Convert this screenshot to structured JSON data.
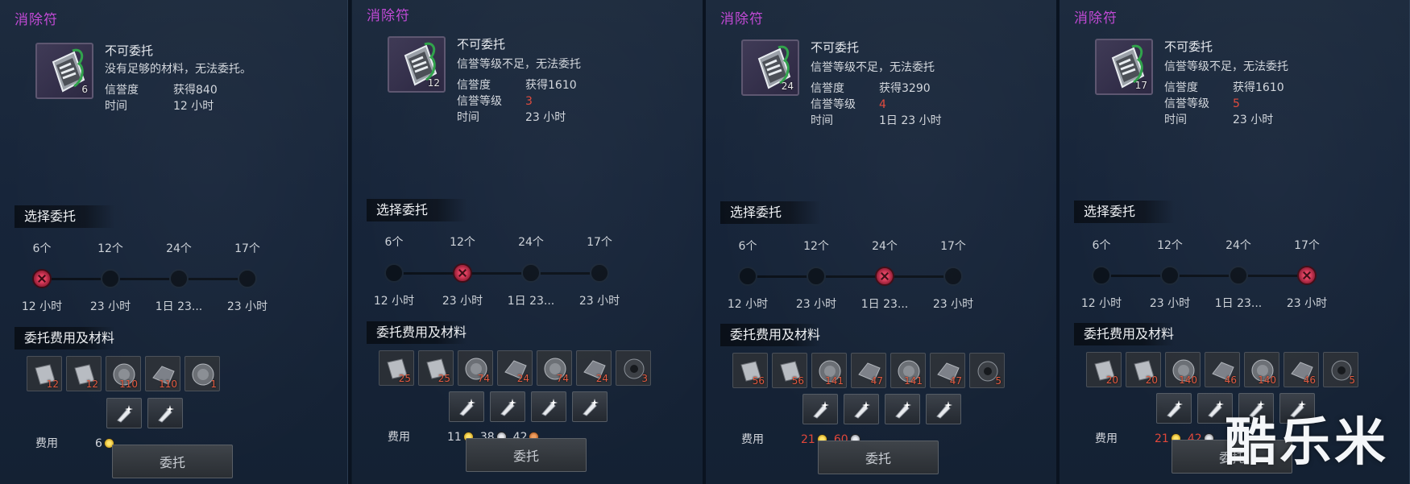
{
  "panels": [
    {
      "title": "消除符",
      "item_name": "不可委托",
      "reason": "没有足够的材料，无法委托。",
      "thumb_count": "6",
      "info": [
        {
          "key": "信誉度",
          "value": "获得840",
          "red": false
        },
        {
          "key": "时间",
          "value": "12 小时",
          "red": false
        }
      ],
      "section_select": "选择委托",
      "options": [
        {
          "count": "6个",
          "time": "12 小时"
        },
        {
          "count": "12个",
          "time": "23 小时"
        },
        {
          "count": "24个",
          "time": "1日 23..."
        },
        {
          "count": "17个",
          "time": "23 小时"
        }
      ],
      "selected_index": 0,
      "section_materials": "委托费用及材料",
      "materials": [
        "12",
        "12",
        "110",
        "110",
        "1"
      ],
      "sub_materials": 2,
      "fee_label": "费用",
      "fees": [
        {
          "amount": "6",
          "coin": "gold",
          "red": false
        }
      ],
      "button": "委托"
    },
    {
      "title": "消除符",
      "item_name": "不可委托",
      "reason": "信誉等级不足，无法委托",
      "thumb_count": "12",
      "info": [
        {
          "key": "信誉度",
          "value": "获得1610",
          "red": false
        },
        {
          "key": "信誉等级",
          "value": "3",
          "red": true
        },
        {
          "key": "时间",
          "value": "23 小时",
          "red": false
        }
      ],
      "section_select": "选择委托",
      "options": [
        {
          "count": "6个",
          "time": "12 小时"
        },
        {
          "count": "12个",
          "time": "23 小时"
        },
        {
          "count": "24个",
          "time": "1日 23..."
        },
        {
          "count": "17个",
          "time": "23 小时"
        }
      ],
      "selected_index": 1,
      "section_materials": "委托费用及材料",
      "materials": [
        "25",
        "25",
        "74",
        "24",
        "74",
        "24",
        "3"
      ],
      "sub_materials": 4,
      "fee_label": "费用",
      "fees": [
        {
          "amount": "11",
          "coin": "gold",
          "red": false
        },
        {
          "amount": "38",
          "coin": "silver",
          "red": false
        },
        {
          "amount": "42",
          "coin": "copper",
          "red": false
        }
      ],
      "button": "委托"
    },
    {
      "title": "消除符",
      "item_name": "不可委托",
      "reason": "信誉等级不足，无法委托",
      "thumb_count": "24",
      "info": [
        {
          "key": "信誉度",
          "value": "获得3290",
          "red": false
        },
        {
          "key": "信誉等级",
          "value": "4",
          "red": true
        },
        {
          "key": "时间",
          "value": "1日 23 小时",
          "red": false
        }
      ],
      "section_select": "选择委托",
      "options": [
        {
          "count": "6个",
          "time": "12 小时"
        },
        {
          "count": "12个",
          "time": "23 小时"
        },
        {
          "count": "24个",
          "time": "1日 23..."
        },
        {
          "count": "17个",
          "time": "23 小时"
        }
      ],
      "selected_index": 2,
      "section_materials": "委托费用及材料",
      "materials": [
        "56",
        "56",
        "141",
        "47",
        "141",
        "47",
        "5"
      ],
      "sub_materials": 4,
      "fee_label": "费用",
      "fees": [
        {
          "amount": "21",
          "coin": "gold",
          "red": true
        },
        {
          "amount": "60",
          "coin": "silver",
          "red": true
        }
      ],
      "button": "委托"
    },
    {
      "title": "消除符",
      "item_name": "不可委托",
      "reason": "信誉等级不足，无法委托",
      "thumb_count": "17",
      "info": [
        {
          "key": "信誉度",
          "value": "获得1610",
          "red": false
        },
        {
          "key": "信誉等级",
          "value": "5",
          "red": true
        },
        {
          "key": "时间",
          "value": "23 小时",
          "red": false
        }
      ],
      "section_select": "选择委托",
      "options": [
        {
          "count": "6个",
          "time": "12 小时"
        },
        {
          "count": "12个",
          "time": "23 小时"
        },
        {
          "count": "24个",
          "time": "1日 23..."
        },
        {
          "count": "17个",
          "time": "23 小时"
        }
      ],
      "selected_index": 3,
      "section_materials": "委托费用及材料",
      "materials": [
        "20",
        "20",
        "140",
        "46",
        "140",
        "46",
        "5"
      ],
      "sub_materials": 4,
      "fee_label": "费用",
      "fees": [
        {
          "amount": "21",
          "coin": "gold",
          "red": true
        },
        {
          "amount": "42",
          "coin": "silver",
          "red": true
        }
      ],
      "button": "委托"
    }
  ],
  "watermark": "酷乐米",
  "colors": {
    "title": "#c24ad6",
    "warning": "#e0473a",
    "panel_bg": "#1a283b"
  }
}
